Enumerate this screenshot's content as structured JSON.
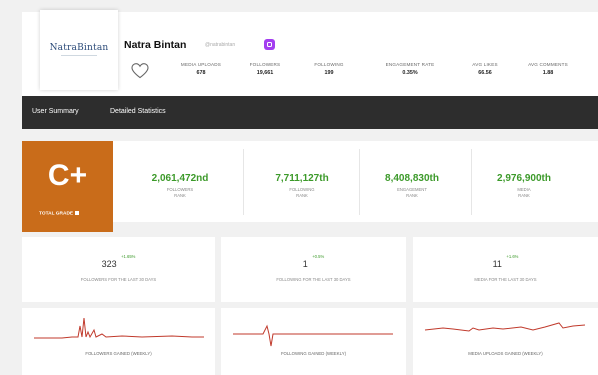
{
  "profile": {
    "name": "Natra Bintan",
    "handle": "@natrabintan",
    "logo_text": "NatraBintan"
  },
  "stats": [
    {
      "label": "MEDIA UPLOADS",
      "value": "678"
    },
    {
      "label": "FOLLOWERS",
      "value": "19,661"
    },
    {
      "label": "FOLLOWING",
      "value": "199"
    },
    {
      "label": "ENGAGEMENT RATE",
      "value": "0.35%"
    },
    {
      "label": "AVG LIKES",
      "value": "66.56"
    },
    {
      "label": "AVG COMMENTS",
      "value": "1.88"
    }
  ],
  "tabs": [
    "User Summary",
    "Detailed Statistics"
  ],
  "grade": {
    "value": "C+",
    "label": "TOTAL GRADE"
  },
  "ranks": [
    {
      "value": "2,061,472nd",
      "label1": "FOLLOWERS",
      "label2": "RANK"
    },
    {
      "value": "7,711,127th",
      "label1": "FOLLOWING",
      "label2": "RANK"
    },
    {
      "value": "8,408,830th",
      "label1": "ENGAGEMENT",
      "label2": "RANK"
    },
    {
      "value": "2,976,900th",
      "label1": "MEDIA",
      "label2": "RANK"
    }
  ],
  "gains": [
    {
      "value": "323",
      "delta": "+1.65%",
      "label": "FOLLOWERS FOR THE LAST 30 DAYS"
    },
    {
      "value": "1",
      "delta": "+0.5%",
      "label": "FOLLOWING FOR THE LAST 30 DAYS"
    },
    {
      "value": "11",
      "delta": "+1.6%",
      "label": "MEDIA FOR THE LAST 30 DAYS"
    }
  ],
  "charts": [
    {
      "label": "FOLLOWERS GAINED (WEEKLY)"
    },
    {
      "label": "FOLLOWING GAINED (WEEKLY)"
    },
    {
      "label": "MEDIA UPLOADS GAINED (WEEKLY)"
    }
  ],
  "colors": {
    "grade": "#c96c1a",
    "navbar": "#2d2d2d",
    "positive": "#3c9a2a",
    "chart_line": "#c0392b",
    "instagram": "#a33df0"
  }
}
